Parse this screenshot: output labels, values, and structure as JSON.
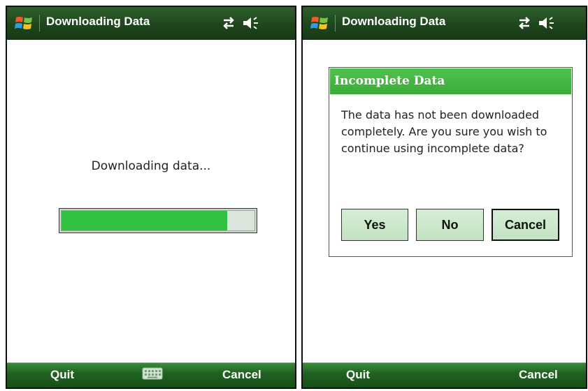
{
  "screens": [
    {
      "title": "Downloading Data",
      "message": "Downloading data...",
      "progress_fraction": 0.86,
      "softkeys": {
        "left": "Quit",
        "right": "Cancel"
      }
    },
    {
      "title": "Downloading Data",
      "dialog": {
        "title": "Incomplete Data",
        "message": "The data has not been downloaded completely. Are you sure you wish to continue using incomplete data?",
        "buttons": {
          "yes": "Yes",
          "no": "No",
          "cancel": "Cancel"
        },
        "default_button": "cancel"
      },
      "softkeys": {
        "left": "Quit",
        "right": "Cancel"
      }
    }
  ],
  "icons": {
    "start": "windows-start-icon",
    "sync": "data-sync-arrows-icon",
    "volume": "speaker-volume-icon",
    "keyboard": "keyboard-icon"
  },
  "colors": {
    "titlebar": "#1f461d",
    "softbar": "#216322",
    "dialog_title": "#46b843",
    "progress_fill": "#31c141",
    "button_fill": "#cfe8ce"
  }
}
